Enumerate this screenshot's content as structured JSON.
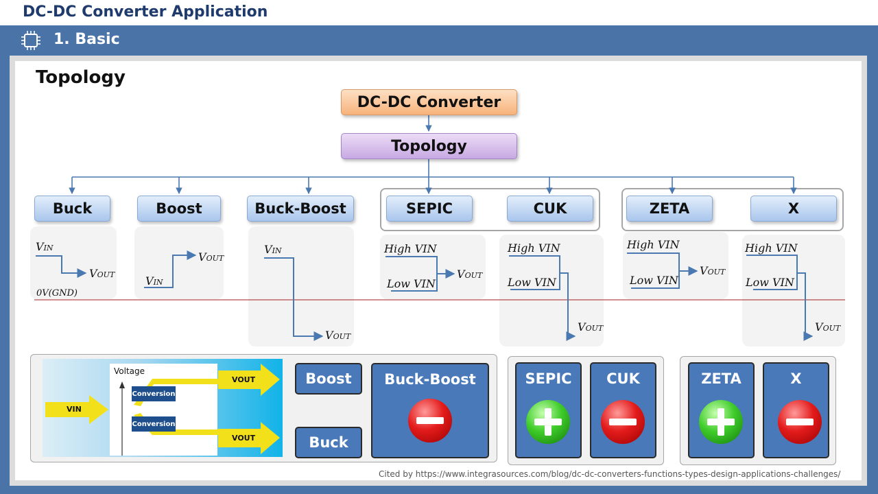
{
  "header": {
    "app_title": "DC-DC Converter Application",
    "section_title": "1. Basic",
    "section_icon": "chip-icon"
  },
  "diagram": {
    "heading": "Topology",
    "root": "DC-DC Converter",
    "middle": "Topology",
    "leaves": [
      "Buck",
      "Boost",
      "Buck-Boost",
      "SEPIC",
      "CUK",
      "ZETA",
      "X"
    ]
  },
  "waveforms": {
    "vin": "V",
    "vin_sub": "IN",
    "vout": "V",
    "vout_sub": "OUT",
    "high_vin": "High VIN",
    "low_vin": "Low VIN",
    "ground": "0V(GND)"
  },
  "flow": {
    "voltage": "Voltage",
    "vin": "VIN",
    "vout": "VOUT",
    "conversion": "Conversion"
  },
  "cards": {
    "boost": "Boost",
    "buck": "Buck",
    "buck_boost": "Buck-Boost",
    "sepic": "SEPIC",
    "cuk": "CUK",
    "zeta": "ZETA",
    "x": "X"
  },
  "citation": "Cited by https://www.integrasources.com/blog/dc-dc-converters-functions-types-design-applications-challenges/",
  "colors": {
    "header_blue": "#4a73a8",
    "minus_red": "#e31b1b",
    "plus_green": "#3fcc2a"
  }
}
